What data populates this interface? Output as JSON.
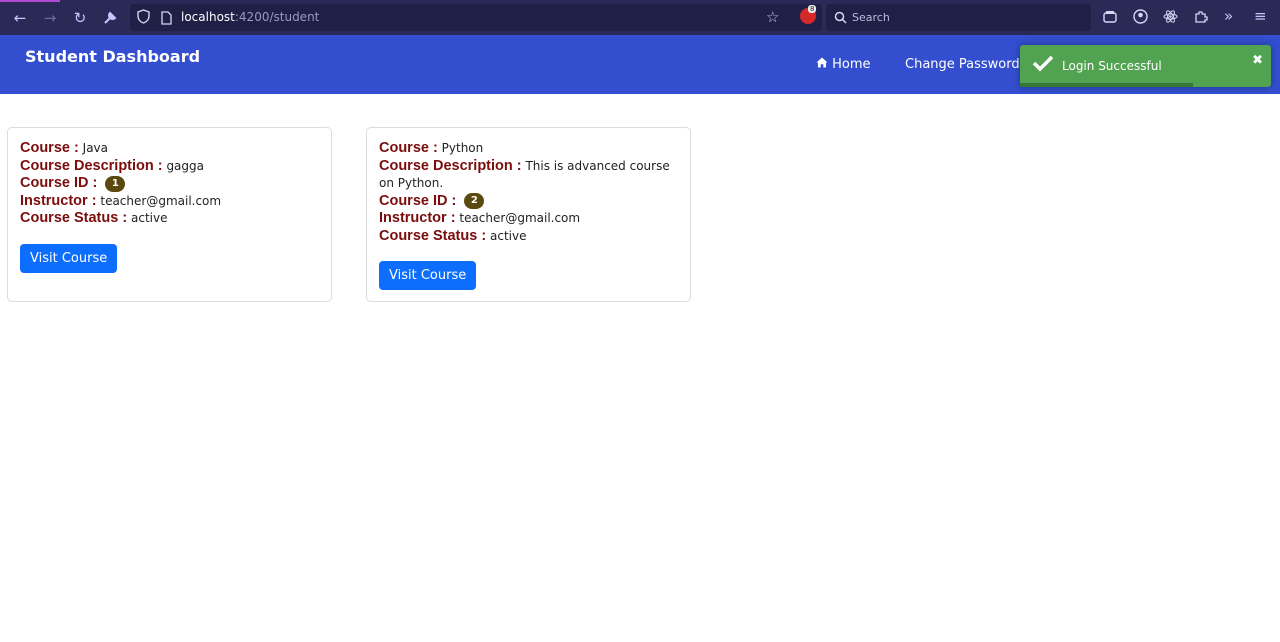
{
  "browser": {
    "url_host": "localhost",
    "url_path": ":4200/student",
    "search_placeholder": "Search",
    "extension_badge": "8"
  },
  "header": {
    "title": "Student Dashboard",
    "nav": {
      "home_label": "Home",
      "change_password_label": "Change Password"
    }
  },
  "toast": {
    "message": "Login Successful",
    "progress": 0.69
  },
  "labels": {
    "course": "Course :",
    "description": "Course Description :",
    "course_id": "Course ID :",
    "instructor": "Instructor :",
    "status": "Course Status :"
  },
  "courses": [
    {
      "name": "Java",
      "description": "gagga",
      "id": "1",
      "instructor": "teacher@gmail.com",
      "status": "active",
      "button": "Visit Course"
    },
    {
      "name": "Python",
      "description": "This is advanced course on Python.",
      "id": "2",
      "instructor": "teacher@gmail.com",
      "status": "active",
      "button": "Visit Course"
    }
  ],
  "colors": {
    "header_bg": "#334fd0",
    "label": "#7b0d0d",
    "button": "#0d6efd",
    "toast": "#51a351",
    "badge": "#5b4a10"
  }
}
